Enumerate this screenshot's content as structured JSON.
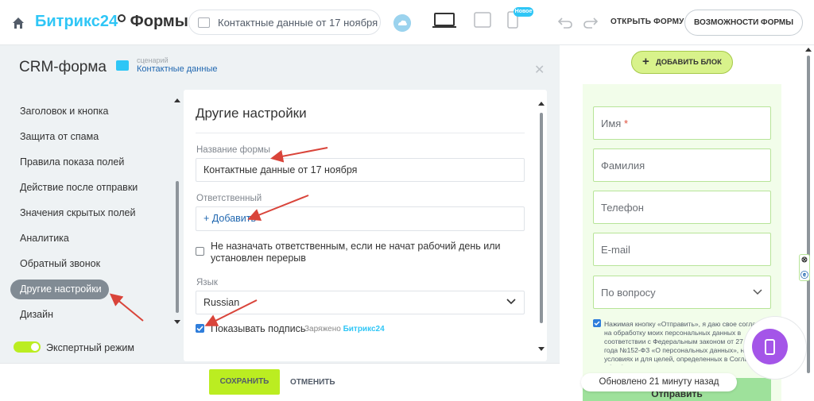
{
  "header": {
    "brand_left": "Битрикс24",
    "brand_right": "Формы",
    "form_title": "Контактные данные от 17 ноября",
    "new_badge": "Новое",
    "open_form": "ОТКРЫТЬ ФОРМУ",
    "form_features": "ВОЗМОЖНОСТИ ФОРМЫ",
    "icons": [
      "home-icon",
      "cloud-icon",
      "desktop-icon",
      "tablet-icon",
      "phone-icon",
      "undo-icon",
      "redo-icon"
    ]
  },
  "left": {
    "title": "CRM-форма",
    "scenario_label": "сценарий",
    "scenario_value": "Контактные данные",
    "nav_items": [
      "Заголовок и кнопка",
      "Защита от спама",
      "Правила показа полей",
      "Действие после отправки",
      "Значения скрытых полей",
      "Аналитика",
      "Обратный звонок",
      "Другие настройки",
      "Дизайн"
    ],
    "active_index": 7,
    "expert_mode": "Экспертный режим",
    "expert_mode_on": true
  },
  "settings": {
    "title": "Другие настройки",
    "form_name_label": "Название формы",
    "form_name_value": "Контактные данные от 17 ноября",
    "responsible_label": "Ответственный",
    "responsible_add": "+ Добавить",
    "no_assign_text": "Не назначать ответственным, если не начат рабочий день или установлен перерыв",
    "no_assign_checked": false,
    "language_label": "Язык",
    "language_value": "Russian",
    "show_sign_text": "Показывать подпись",
    "show_sign_checked": true,
    "powered_prefix": "Заряжено",
    "powered_brand": "Битрикс24"
  },
  "footer": {
    "save": "СОХРАНИТЬ",
    "cancel": "ОТМЕНИТЬ"
  },
  "preview": {
    "add_block": "ДОБАВИТЬ БЛОК",
    "fields": [
      {
        "label": "Имя",
        "required": true
      },
      {
        "label": "Фамилия",
        "required": false
      },
      {
        "label": "Телефон",
        "required": false
      },
      {
        "label": "E-mail",
        "required": false
      },
      {
        "label": "По вопросу",
        "required": false
      }
    ],
    "consent_text": "Нажимая кнопку «Отправить», я даю свое согласие на обработку моих персональных данных в соответствии с Федеральным законом от 27.07.2006 года №152-ФЗ «О персональных данных», на условиях и для целей, определенных в Согласии на обработку персональных данных *",
    "submit": "Отправить",
    "updated": "Обновлено 21 минуту назад"
  },
  "colors": {
    "accent_blue": "#2fc6f6",
    "link_blue": "#2067b0",
    "lime": "#bbed21",
    "active_nav": "#818b94",
    "annotation_arrow": "#d9443a"
  }
}
